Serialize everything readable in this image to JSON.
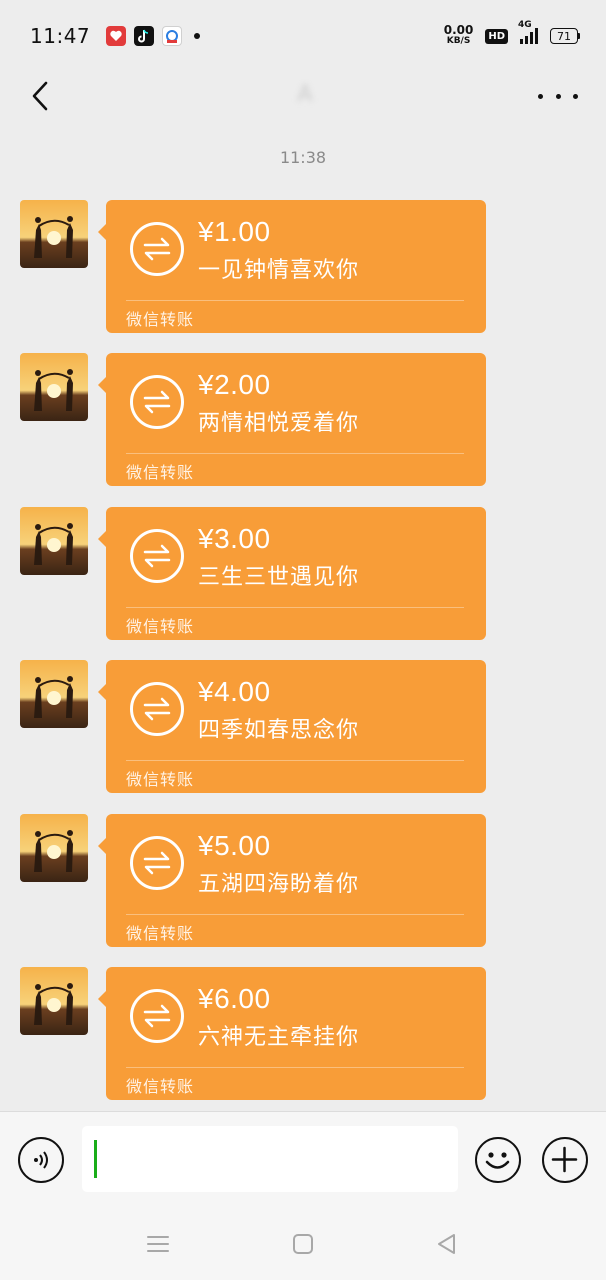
{
  "status_bar": {
    "time": "11:47",
    "apps": [
      "health-app-icon",
      "tiktok-icon",
      "browser-icon"
    ],
    "net_speed_value": "0.00",
    "net_speed_unit": "KB/S",
    "hd": "HD",
    "network": "4G",
    "battery": "71"
  },
  "header": {
    "title": "A"
  },
  "timestamp": "11:38",
  "messages": [
    {
      "amount": "¥1.00",
      "note": "一见钟情喜欢你",
      "footer": "微信转账"
    },
    {
      "amount": "¥2.00",
      "note": "两情相悦爱着你",
      "footer": "微信转账"
    },
    {
      "amount": "¥3.00",
      "note": "三生三世遇见你",
      "footer": "微信转账"
    },
    {
      "amount": "¥4.00",
      "note": "四季如春思念你",
      "footer": "微信转账"
    },
    {
      "amount": "¥5.00",
      "note": "五湖四海盼着你",
      "footer": "微信转账"
    },
    {
      "amount": "¥6.00",
      "note": "六神无主牵挂你",
      "footer": "微信转账"
    }
  ],
  "colors": {
    "bubble": "#f89d38",
    "background": "#ededed",
    "caret": "#1aad19"
  }
}
